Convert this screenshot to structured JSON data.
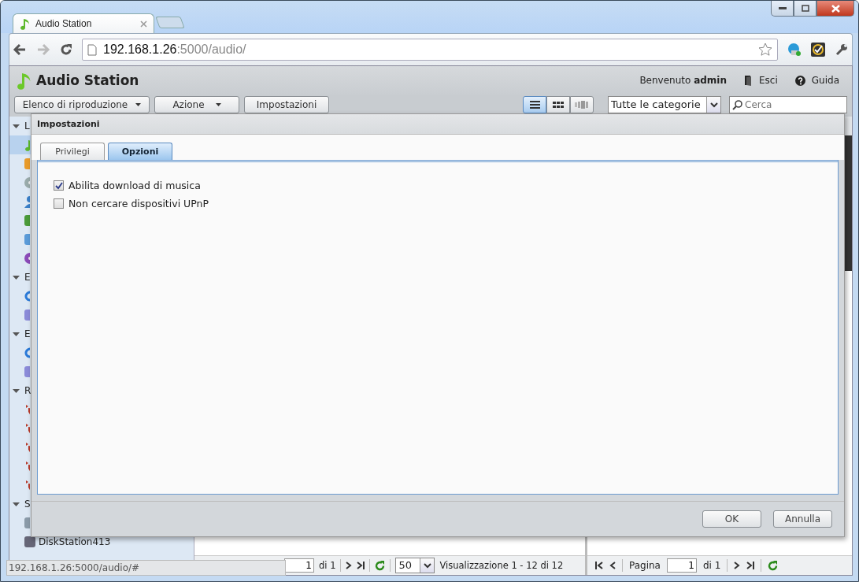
{
  "browser": {
    "tab_title": "Audio Station",
    "url_host": "192.168.1.26",
    "url_rest": ":5000/audio/",
    "status_url": "192.168.1.26:5000/audio/#"
  },
  "app": {
    "title": "Audio Station",
    "welcome": "Benvenuto",
    "user": "admin",
    "logout": "Esci",
    "help": "Guida",
    "toolbar": [
      {
        "label": "Elenco di riproduzione",
        "dropdown": true
      },
      {
        "label": "Azione",
        "dropdown": true
      },
      {
        "label": "Impostazioni",
        "dropdown": false
      }
    ],
    "views": [
      {
        "kind": "list",
        "selected": true
      },
      {
        "kind": "grid",
        "selected": false
      },
      {
        "kind": "flow",
        "selected": false
      }
    ],
    "category": "Tutte le categorie",
    "search": {
      "placeholder": "Cerca"
    }
  },
  "sidebar": [
    {
      "label": "L",
      "items": [
        {
          "kind": "music",
          "selected": true
        },
        {
          "kind": "folder",
          "selected": false
        },
        {
          "kind": "disc",
          "selected": false
        },
        {
          "kind": "person",
          "selected": false
        },
        {
          "kind": "device",
          "selected": false
        },
        {
          "kind": "radio",
          "selected": false
        },
        {
          "kind": "podcast",
          "selected": false
        }
      ]
    },
    {
      "label": "E",
      "items": [
        {
          "kind": "refresh",
          "selected": false
        },
        {
          "kind": "list",
          "selected": false
        }
      ]
    },
    {
      "label": "E",
      "items": [
        {
          "kind": "refresh",
          "selected": false
        },
        {
          "kind": "list",
          "selected": false
        }
      ]
    },
    {
      "label": "R",
      "items": [
        {
          "kind": "playlist",
          "selected": false
        },
        {
          "kind": "playlist",
          "selected": false
        },
        {
          "kind": "playlist",
          "selected": false
        },
        {
          "kind": "playlist",
          "selected": false
        },
        {
          "kind": "playlist",
          "selected": false
        }
      ]
    },
    {
      "label": "S",
      "items": [
        {
          "kind": "computer",
          "selected": false
        },
        {
          "kind": "server",
          "selected": false,
          "label": "DiskStation413"
        }
      ]
    }
  ],
  "center_pager": {
    "page": "1",
    "of": "di 1",
    "page_size": "50",
    "summary": "Visualizzazione 1 - 12 di 12"
  },
  "right_pager": {
    "label": "Pagina",
    "page": "1",
    "of": "di 1"
  },
  "dialog": {
    "title": "Impostazioni",
    "tabs": [
      {
        "label": "Privilegi",
        "selected": false
      },
      {
        "label": "Opzioni",
        "selected": true
      }
    ],
    "options": [
      {
        "label": "Abilita download di musica",
        "checked": true
      },
      {
        "label": "Non cercare dispositivi UPnP",
        "checked": false
      }
    ],
    "buttons": [
      "OK",
      "Annulla"
    ]
  }
}
